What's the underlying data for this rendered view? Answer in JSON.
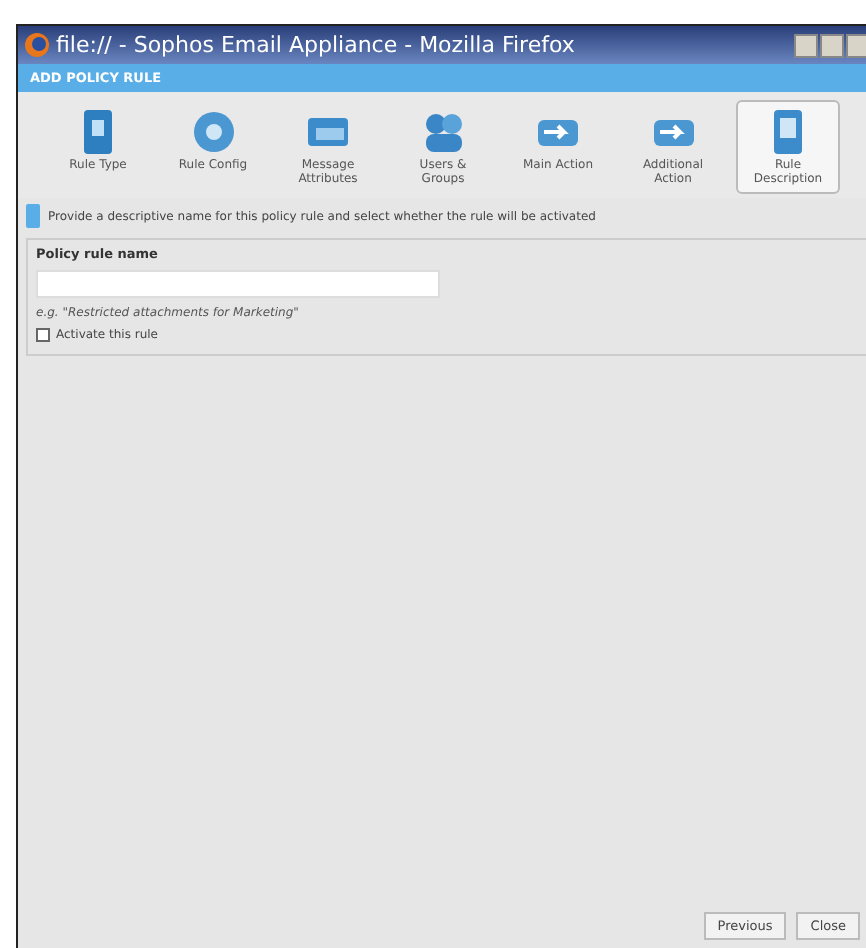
{
  "window": {
    "title": "file:// - Sophos Email Appliance - Mozilla Firefox"
  },
  "header": {
    "title": "ADD POLICY RULE"
  },
  "steps": [
    {
      "label": "Rule Type",
      "selected": false,
      "kind": "question"
    },
    {
      "label": "Rule Config",
      "selected": false,
      "kind": "gear"
    },
    {
      "label": "Message Attributes",
      "selected": false,
      "kind": "envelope"
    },
    {
      "label": "Users & Groups",
      "selected": false,
      "kind": "users"
    },
    {
      "label": "Main Action",
      "selected": false,
      "kind": "arrow"
    },
    {
      "label": "Additional Action",
      "selected": false,
      "kind": "arrow"
    },
    {
      "label": "Rule Description",
      "selected": true,
      "kind": "document"
    }
  ],
  "info": "Provide a descriptive name for this policy rule and select whether the rule will be activated",
  "form": {
    "name_label": "Policy rule name",
    "example": "e.g. \"Restricted attachments for Marketing\"",
    "activate_label": "Activate this rule",
    "activate_checked": false
  },
  "buttons": [
    "Previous",
    "Close"
  ]
}
